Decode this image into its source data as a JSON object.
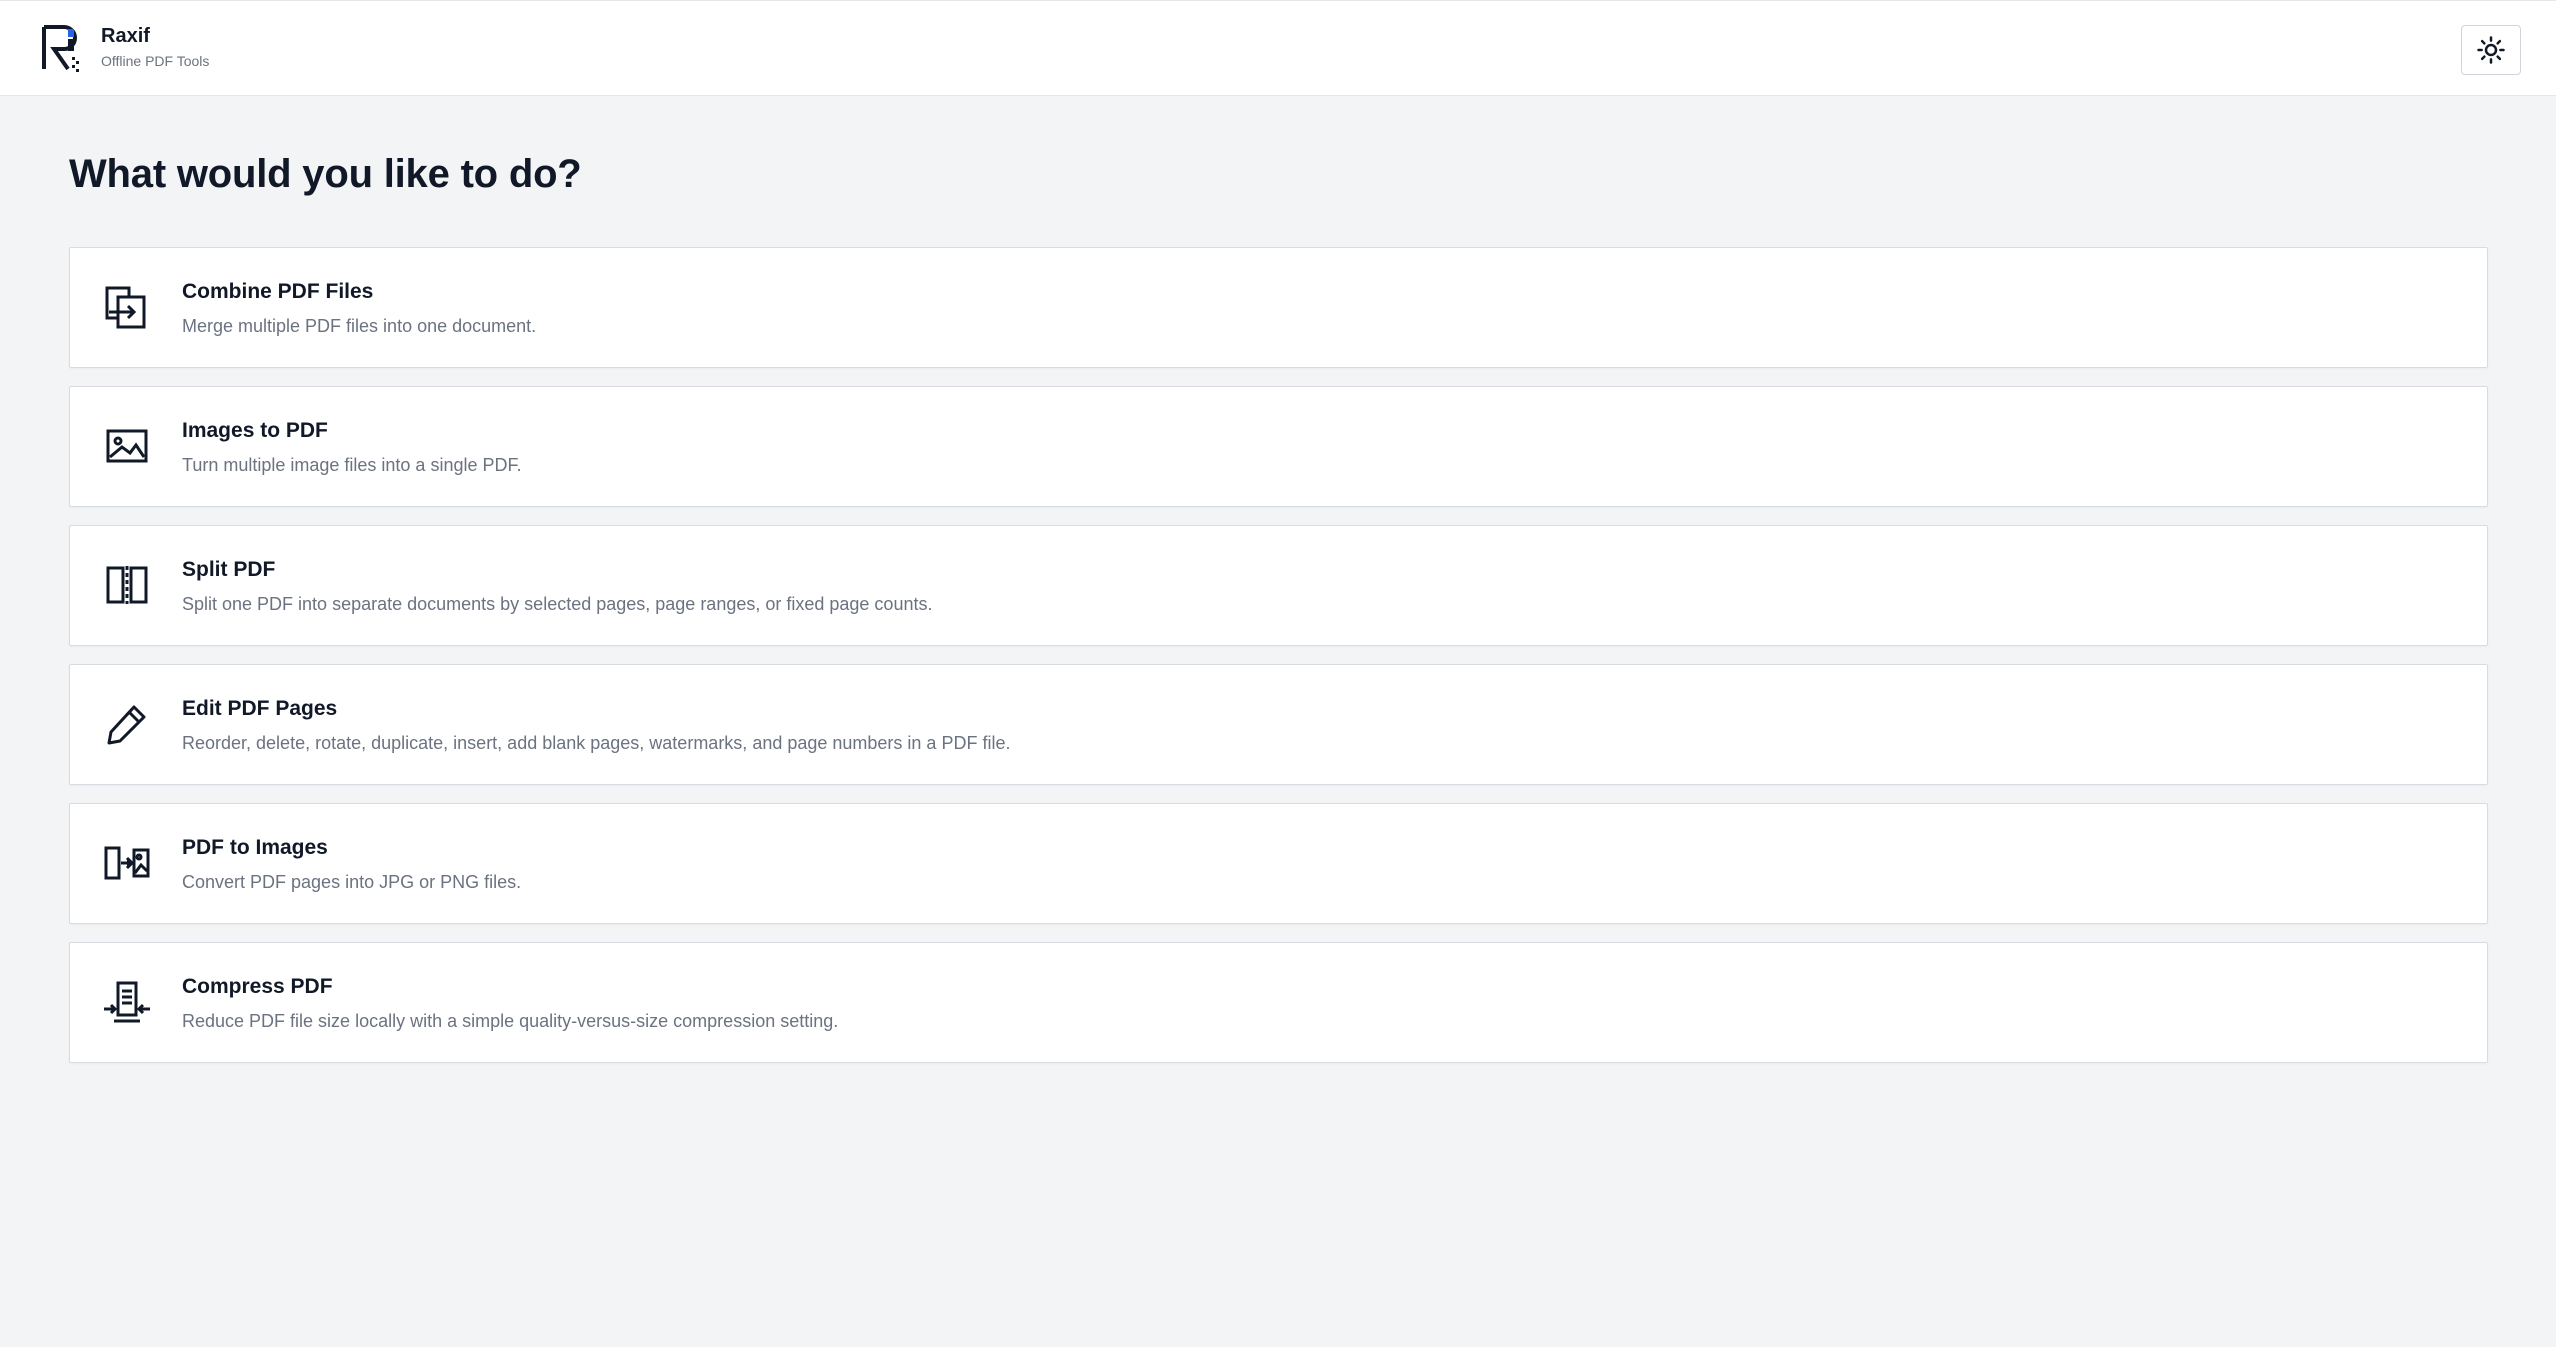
{
  "app": {
    "name": "Raxif",
    "subtitle": "Offline PDF Tools",
    "logo_icon": "raxif-logo-icon",
    "theme_toggle_icon": "sun-icon"
  },
  "main": {
    "heading": "What would you like to do?",
    "tools": [
      {
        "icon": "combine-files-icon",
        "title": "Combine PDF Files",
        "description": "Merge multiple PDF files into one document."
      },
      {
        "icon": "image-icon",
        "title": "Images to PDF",
        "description": "Turn multiple image files into a single PDF."
      },
      {
        "icon": "split-icon",
        "title": "Split PDF",
        "description": "Split one PDF into separate documents by selected pages, page ranges, or fixed page counts."
      },
      {
        "icon": "pencil-icon",
        "title": "Edit PDF Pages",
        "description": "Reorder, delete, rotate, duplicate, insert, add blank pages, watermarks, and page numbers in a PDF file."
      },
      {
        "icon": "pdf-to-image-icon",
        "title": "PDF to Images",
        "description": "Convert PDF pages into JPG or PNG files."
      },
      {
        "icon": "compress-icon",
        "title": "Compress PDF",
        "description": "Reduce PDF file size locally with a simple quality-versus-size compression setting."
      }
    ]
  },
  "colors": {
    "background": "#f3f4f6",
    "card": "#ffffff",
    "text": "#111827",
    "muted": "#6b7280",
    "logo_accent": "#2563eb"
  }
}
